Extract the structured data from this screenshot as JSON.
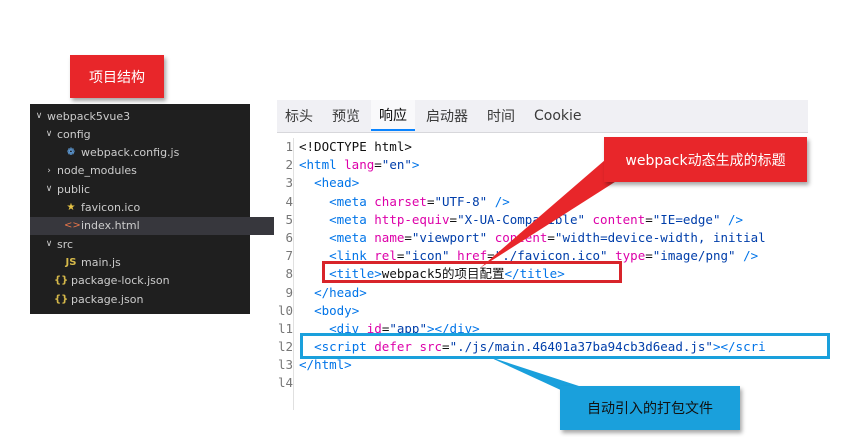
{
  "labels": {
    "structure": "项目结构",
    "title_callout": "webpack动态生成的标题",
    "bundle_callout": "自动引入的打包文件"
  },
  "explorer": {
    "items": [
      {
        "name": "webpack5vue3",
        "depth": 0,
        "chev": "∨",
        "icon": ""
      },
      {
        "name": "config",
        "depth": 1,
        "chev": "∨",
        "icon": ""
      },
      {
        "name": "webpack.config.js",
        "depth": 2,
        "chev": "",
        "icon": "gear-icon"
      },
      {
        "name": "node_modules",
        "depth": 1,
        "chev": "›",
        "icon": ""
      },
      {
        "name": "public",
        "depth": 1,
        "chev": "∨",
        "icon": ""
      },
      {
        "name": "favicon.ico",
        "depth": 2,
        "chev": "",
        "icon": "star-icon"
      },
      {
        "name": "index.html",
        "depth": 2,
        "chev": "",
        "icon": "html-icon",
        "selected": true
      },
      {
        "name": "src",
        "depth": 1,
        "chev": "∨",
        "icon": ""
      },
      {
        "name": "main.js",
        "depth": 2,
        "chev": "",
        "icon": "js-icon"
      },
      {
        "name": "package-lock.json",
        "depth": 1,
        "chev": "",
        "icon": "json-icon"
      },
      {
        "name": "package.json",
        "depth": 1,
        "chev": "",
        "icon": "json-icon"
      }
    ]
  },
  "devtools": {
    "tabs": [
      "标头",
      "预览",
      "响应",
      "启动器",
      "时间",
      "Cookie"
    ],
    "active_tab": 2,
    "line_numbers": [
      "1",
      "2",
      "3",
      "4",
      "5",
      "6",
      "7",
      "8",
      "9",
      "l0",
      "l1",
      "l2",
      "l3",
      "l4"
    ],
    "lines": [
      [
        [
          "tx",
          "<!DOCTYPE html>"
        ]
      ],
      [
        [
          "tg",
          "<html "
        ],
        [
          "at",
          "lang"
        ],
        [
          "tx",
          "="
        ],
        [
          "av",
          "\"en\""
        ],
        [
          "tg",
          ">"
        ]
      ],
      [
        [
          "tx",
          "  "
        ],
        [
          "tg",
          "<head>"
        ]
      ],
      [
        [
          "tx",
          "    "
        ],
        [
          "tg",
          "<meta "
        ],
        [
          "at",
          "charset"
        ],
        [
          "tx",
          "="
        ],
        [
          "av",
          "\"UTF-8\""
        ],
        [
          "tg",
          " />"
        ]
      ],
      [
        [
          "tx",
          "    "
        ],
        [
          "tg",
          "<meta "
        ],
        [
          "at",
          "http-equiv"
        ],
        [
          "tx",
          "="
        ],
        [
          "av",
          "\"X-UA-Compatible\""
        ],
        [
          "tx",
          " "
        ],
        [
          "at",
          "content"
        ],
        [
          "tx",
          "="
        ],
        [
          "av",
          "\"IE=edge\""
        ],
        [
          "tg",
          " />"
        ]
      ],
      [
        [
          "tx",
          "    "
        ],
        [
          "tg",
          "<meta "
        ],
        [
          "at",
          "name"
        ],
        [
          "tx",
          "="
        ],
        [
          "av",
          "\"viewport\""
        ],
        [
          "tx",
          " "
        ],
        [
          "at",
          "content"
        ],
        [
          "tx",
          "="
        ],
        [
          "av",
          "\"width=device-width, initial"
        ]
      ],
      [
        [
          "tx",
          "    "
        ],
        [
          "tg",
          "<link "
        ],
        [
          "at",
          "rel"
        ],
        [
          "tx",
          "="
        ],
        [
          "av",
          "\"icon\""
        ],
        [
          "tx",
          " "
        ],
        [
          "at",
          "href"
        ],
        [
          "tx",
          "="
        ],
        [
          "av",
          "\"./favicon.ico\""
        ],
        [
          "tx",
          " "
        ],
        [
          "at",
          "type"
        ],
        [
          "tx",
          "="
        ],
        [
          "av",
          "\"image/png\""
        ],
        [
          "tg",
          " />"
        ]
      ],
      [
        [
          "tx",
          "    "
        ],
        [
          "tg",
          "<title>"
        ],
        [
          "tx",
          "webpack5的项目配置"
        ],
        [
          "tg",
          "</title>"
        ]
      ],
      [
        [
          "tx",
          "  "
        ],
        [
          "tg",
          "</head>"
        ]
      ],
      [
        [
          "tx",
          "  "
        ],
        [
          "tg",
          "<body>"
        ]
      ],
      [
        [
          "tx",
          "    "
        ],
        [
          "tg",
          "<div "
        ],
        [
          "at",
          "id"
        ],
        [
          "tx",
          "="
        ],
        [
          "av",
          "\"app\""
        ],
        [
          "tg",
          "></div>"
        ]
      ],
      [
        [
          "tx",
          "  "
        ],
        [
          "tg",
          "<script "
        ],
        [
          "at",
          "defer"
        ],
        [
          "tx",
          " "
        ],
        [
          "at",
          "src"
        ],
        [
          "tx",
          "="
        ],
        [
          "av",
          "\"./js/main.46401a37ba94cb3d6ead.js\""
        ],
        [
          "tg",
          "></scri"
        ]
      ],
      [
        [
          "tg",
          "</html>"
        ]
      ],
      []
    ]
  },
  "colors": {
    "callout_red": "#e8262a",
    "callout_blue": "#1aa0dc",
    "tab_active_underline": "#0a84ff",
    "explorer_bg": "#1f1f1f"
  }
}
